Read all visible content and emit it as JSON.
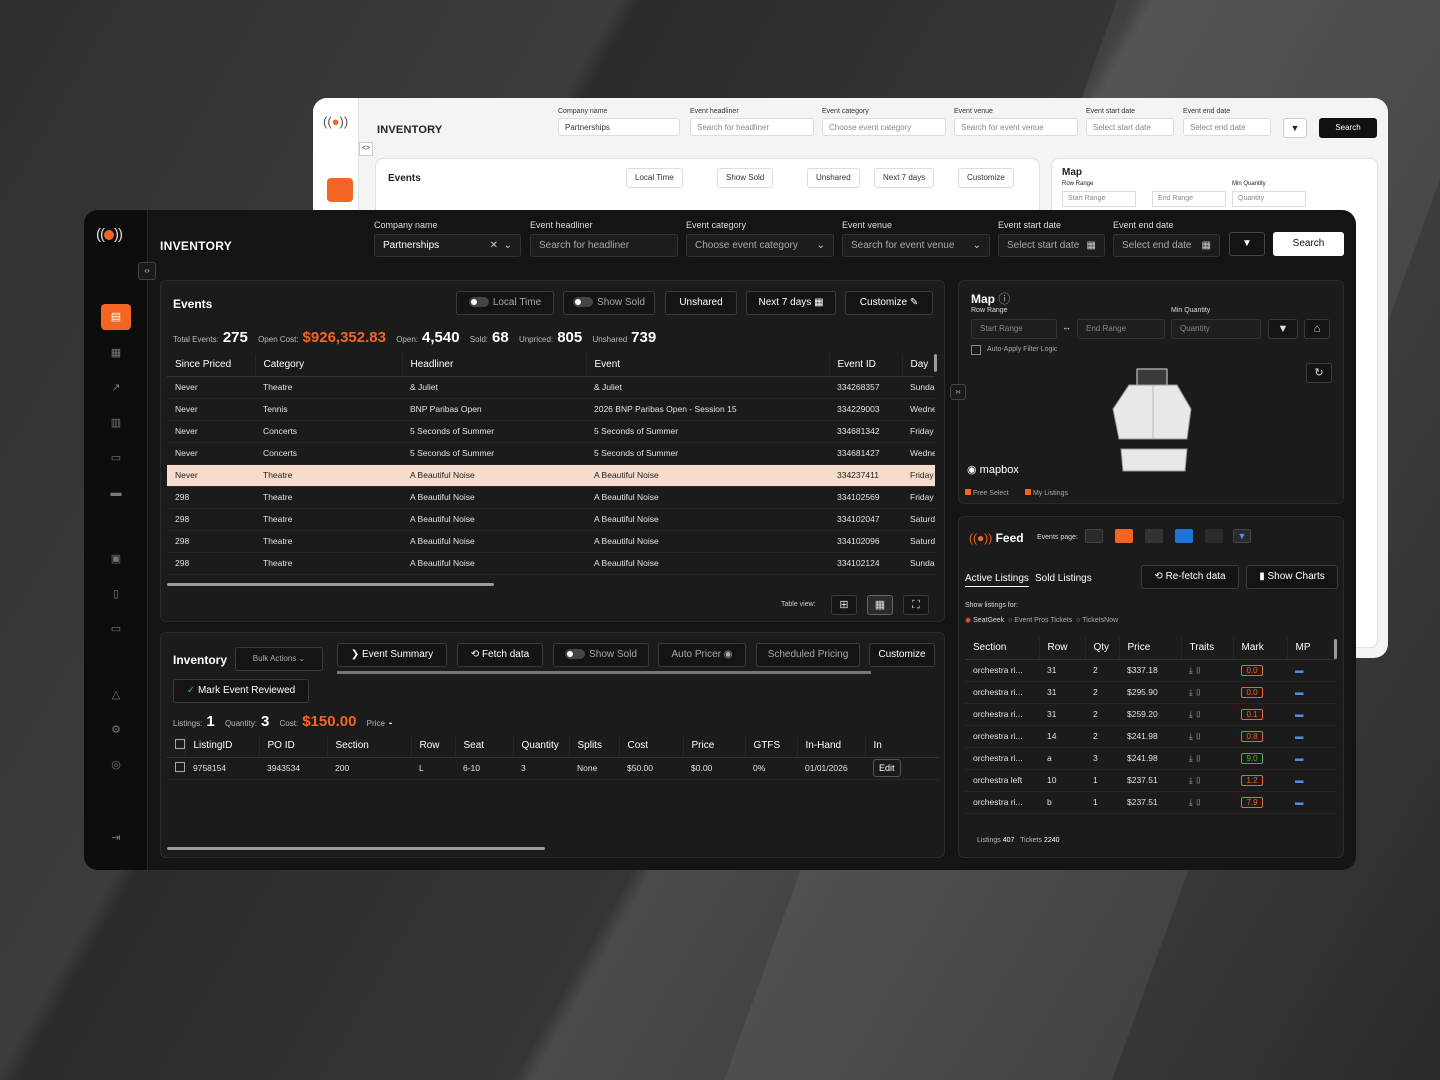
{
  "app": {
    "title": "INVENTORY",
    "colors": {
      "accent": "#f26522",
      "bg": "#141414"
    }
  },
  "filters": [
    {
      "label": "Company name",
      "value": "Partnerships"
    },
    {
      "label": "Event headliner",
      "placeholder": "Search for headliner"
    },
    {
      "label": "Event category",
      "placeholder": "Choose event category"
    },
    {
      "label": "Event venue",
      "placeholder": "Search for event venue"
    },
    {
      "label": "Event start date",
      "placeholder": "Select start date"
    },
    {
      "label": "Event end date",
      "placeholder": "Select end date"
    }
  ],
  "search_label": "Search",
  "events": {
    "title": "Events",
    "buttons": {
      "local_time": "Local Time",
      "show_sold": "Show Sold",
      "unshared": "Unshared",
      "next7": "Next 7 days",
      "customize": "Customize"
    },
    "stats": {
      "total_label": "Total Events:",
      "total": "275",
      "cost_label": "Open Cost:",
      "cost": "$926,352.83",
      "open_label": "Open:",
      "open": "4,540",
      "sold_label": "Sold:",
      "sold": "68",
      "unpriced_label": "Unpriced:",
      "unpriced": "805",
      "unshared_label": "Unshared",
      "unshared": "739"
    },
    "columns": [
      "Since Priced",
      "Category",
      "Headliner",
      "Event",
      "Event ID",
      "Day"
    ],
    "rows": [
      [
        "Never",
        "Theatre",
        "& Juliet",
        "& Juliet",
        "334268357",
        "Sunda"
      ],
      [
        "Never",
        "Tennis",
        "BNP Paribas Open",
        "2026 BNP Paribas Open - Session 15",
        "334229003",
        "Wedne"
      ],
      [
        "Never",
        "Concerts",
        "5 Seconds of Summer",
        "5 Seconds of Summer",
        "334681342",
        "Friday"
      ],
      [
        "Never",
        "Concerts",
        "5 Seconds of Summer",
        "5 Seconds of Summer",
        "334681427",
        "Wedne"
      ],
      [
        "Never",
        "Theatre",
        "A Beautiful Noise",
        "A Beautiful Noise",
        "334237411",
        "Friday"
      ],
      [
        "298",
        "Theatre",
        "A Beautiful Noise",
        "A Beautiful Noise",
        "334102569",
        "Friday"
      ],
      [
        "298",
        "Theatre",
        "A Beautiful Noise",
        "A Beautiful Noise",
        "334102047",
        "Saturd"
      ],
      [
        "298",
        "Theatre",
        "A Beautiful Noise",
        "A Beautiful Noise",
        "334102096",
        "Saturd"
      ],
      [
        "298",
        "Theatre",
        "A Beautiful Noise",
        "A Beautiful Noise",
        "334102124",
        "Sunda"
      ]
    ],
    "table_view_label": "Table view:"
  },
  "inventory": {
    "title": "Inventory",
    "bulk": "Bulk Actions",
    "buttons": {
      "summary": "Event Summary",
      "fetch": "Fetch data",
      "show_sold": "Show Sold",
      "auto": "Auto Pricer",
      "scheduled": "Scheduled Pricing",
      "customize": "Customize",
      "reviewed": "Mark Event Reviewed"
    },
    "stats": {
      "listings_label": "Listings:",
      "listings": "1",
      "qty_label": "Quantity:",
      "qty": "3",
      "cost_label": "Cost:",
      "cost": "$150.00",
      "price_label": "Price",
      "price": "-"
    },
    "columns": [
      "ListingID",
      "PO ID",
      "Section",
      "Row",
      "Seat",
      "Quantity",
      "Splits",
      "Cost",
      "Price",
      "GTFS",
      "In-Hand",
      "In"
    ],
    "rows": [
      [
        "9758154",
        "3943534",
        "200",
        "L",
        "6-10",
        "3",
        "None",
        "$50.00",
        "$0.00",
        "0%",
        "01/01/2026",
        "Edit"
      ]
    ]
  },
  "map": {
    "title": "Map",
    "row_range": "Row Range",
    "start": "Start Range",
    "end": "End Range",
    "min_qty": "Min Quantity",
    "qty": "Quantity",
    "auto": "Auto-Apply Filter Logic",
    "brand": "mapbox",
    "legend": [
      "Free Select",
      "My Listings"
    ]
  },
  "feed": {
    "title": "Feed",
    "events_page": "Events page:",
    "tabs": [
      "Active Listings",
      "Sold Listings"
    ],
    "refetch": "Re-fetch data",
    "charts": "Show Charts",
    "show_for": "Show listings for:",
    "sources": [
      "SeatGeek",
      "Event Pros Tickets",
      "TicketsNow"
    ],
    "columns": [
      "Section",
      "Row",
      "Qty",
      "Price",
      "Traits",
      "Mark",
      "MP"
    ],
    "rows": [
      [
        "orchestra ri...",
        "31",
        "2",
        "$337.18",
        "0.0",
        "o"
      ],
      [
        "orchestra ri...",
        "31",
        "2",
        "$295.90",
        "0.0",
        "o"
      ],
      [
        "orchestra ri...",
        "31",
        "2",
        "$259.20",
        "0.1",
        "o"
      ],
      [
        "orchestra ri...",
        "14",
        "2",
        "$241.98",
        "0.8",
        "o"
      ],
      [
        "orchestra ri...",
        "a",
        "3",
        "$241.98",
        "9.0",
        "g"
      ],
      [
        "orchestra left",
        "10",
        "1",
        "$237.51",
        "1.2",
        "o"
      ],
      [
        "orchestra ri...",
        "b",
        "1",
        "$237.51",
        "7.9",
        "o"
      ]
    ],
    "footer": {
      "listings_label": "Listings",
      "listings": "407",
      "tickets_label": "Tickets",
      "tickets": "2240"
    }
  }
}
